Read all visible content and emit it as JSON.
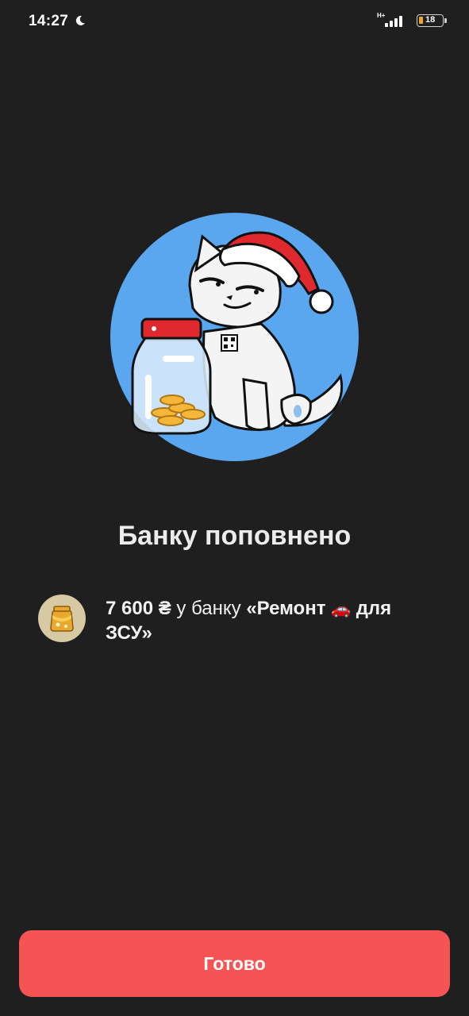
{
  "status_bar": {
    "time": "14:27",
    "network_type": "H+",
    "battery_level": "18",
    "icons": [
      "moon-icon",
      "signal-icon",
      "battery-icon"
    ]
  },
  "title": "Банку поповнено",
  "deposit": {
    "amount": "7 600 ₴",
    "connector": " у банку ",
    "jar_name_start": "«Ремонт ",
    "car_emoji": "🚗",
    "jar_name_end": " для ЗСУ»"
  },
  "done_button_label": "Готово",
  "colors": {
    "background": "#1f1f1f",
    "accent": "#f65354",
    "hero_circle": "#5aa7f0"
  }
}
